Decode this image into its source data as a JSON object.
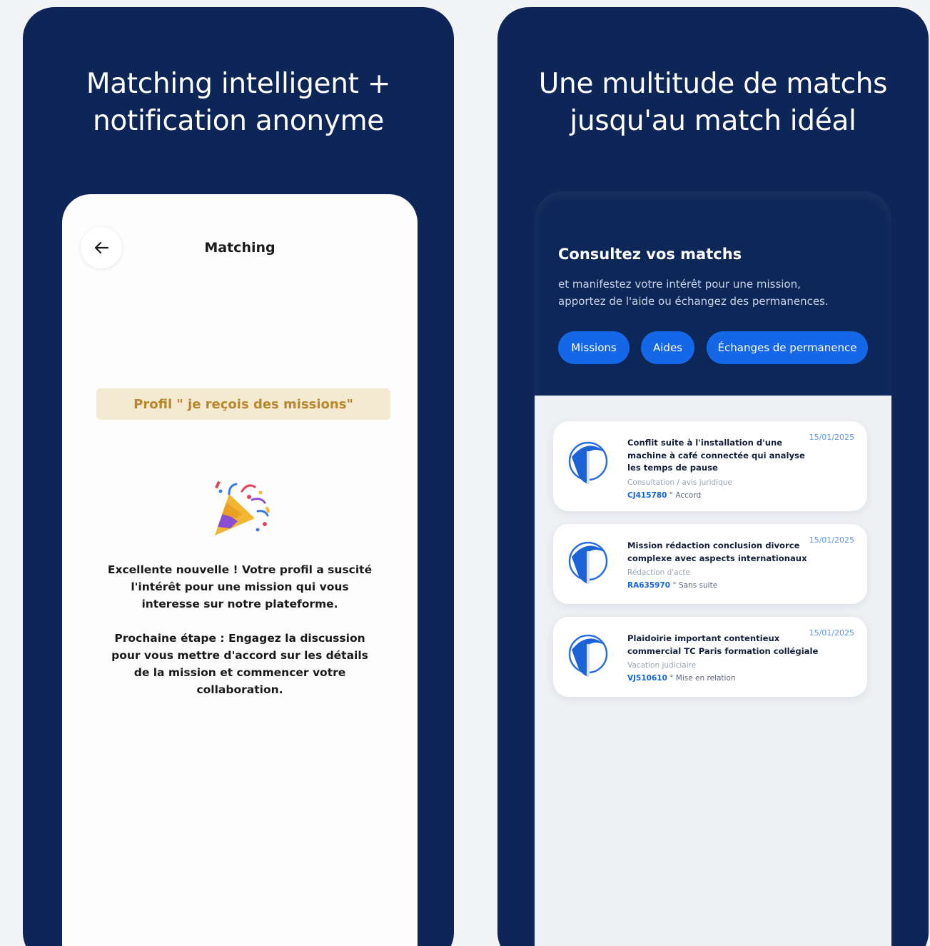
{
  "left_panel": {
    "headline_line1": "Matching intelligent +",
    "headline_line2": "notification anonyme",
    "screen": {
      "title": "Matching",
      "back_icon": "arrow-left-icon",
      "profile_badge": "Profil \" je reçois des missions\"",
      "celebration_icon": "party-popper-icon",
      "message_1": "Excellente nouvelle ! Votre profil a suscité l'intérêt pour une mission qui vous interesse sur notre plateforme.",
      "message_2": "Prochaine étape : Engagez la discussion pour vous mettre d'accord sur les détails de la mission et commencer votre collaboration."
    }
  },
  "right_panel": {
    "headline_line1": "Une multitude de matchs",
    "headline_line2": "jusqu'au match idéal",
    "screen": {
      "title": "Consultez vos matchs",
      "subtitle_line1": "et manifestez votre intérêt pour une mission,",
      "subtitle_line2": "apportez de l'aide ou échangez des permanences.",
      "chips": [
        "Missions",
        "Aides",
        "Échanges de permanence"
      ],
      "cards": [
        {
          "title": "Conflit suite à l'installation d'une machine à café connectée qui analyse les temps de pause",
          "category": "Consultation / avis juridique",
          "reference": "CJ415780",
          "status": "° Accord",
          "date": "15/01/2025"
        },
        {
          "title": "Mission rédaction conclusion divorce complexe avec aspects internationaux",
          "category": "Rédaction d'acte",
          "reference": "RA635970",
          "status": "° Sans suite",
          "date": "15/01/2025"
        },
        {
          "title": "Plaidoirie important contentieux commercial TC Paris formation collégiale",
          "category": "Vacation judiciaire",
          "reference": "VJ510610",
          "status": "° Mise en relation",
          "date": "15/01/2025"
        }
      ]
    }
  },
  "colors": {
    "panel_bg": "#0d2557",
    "chip_blue": "#1468e8",
    "badge_bg": "#f4ead2",
    "badge_text": "#b8872c",
    "ref_blue": "#1565e0"
  }
}
